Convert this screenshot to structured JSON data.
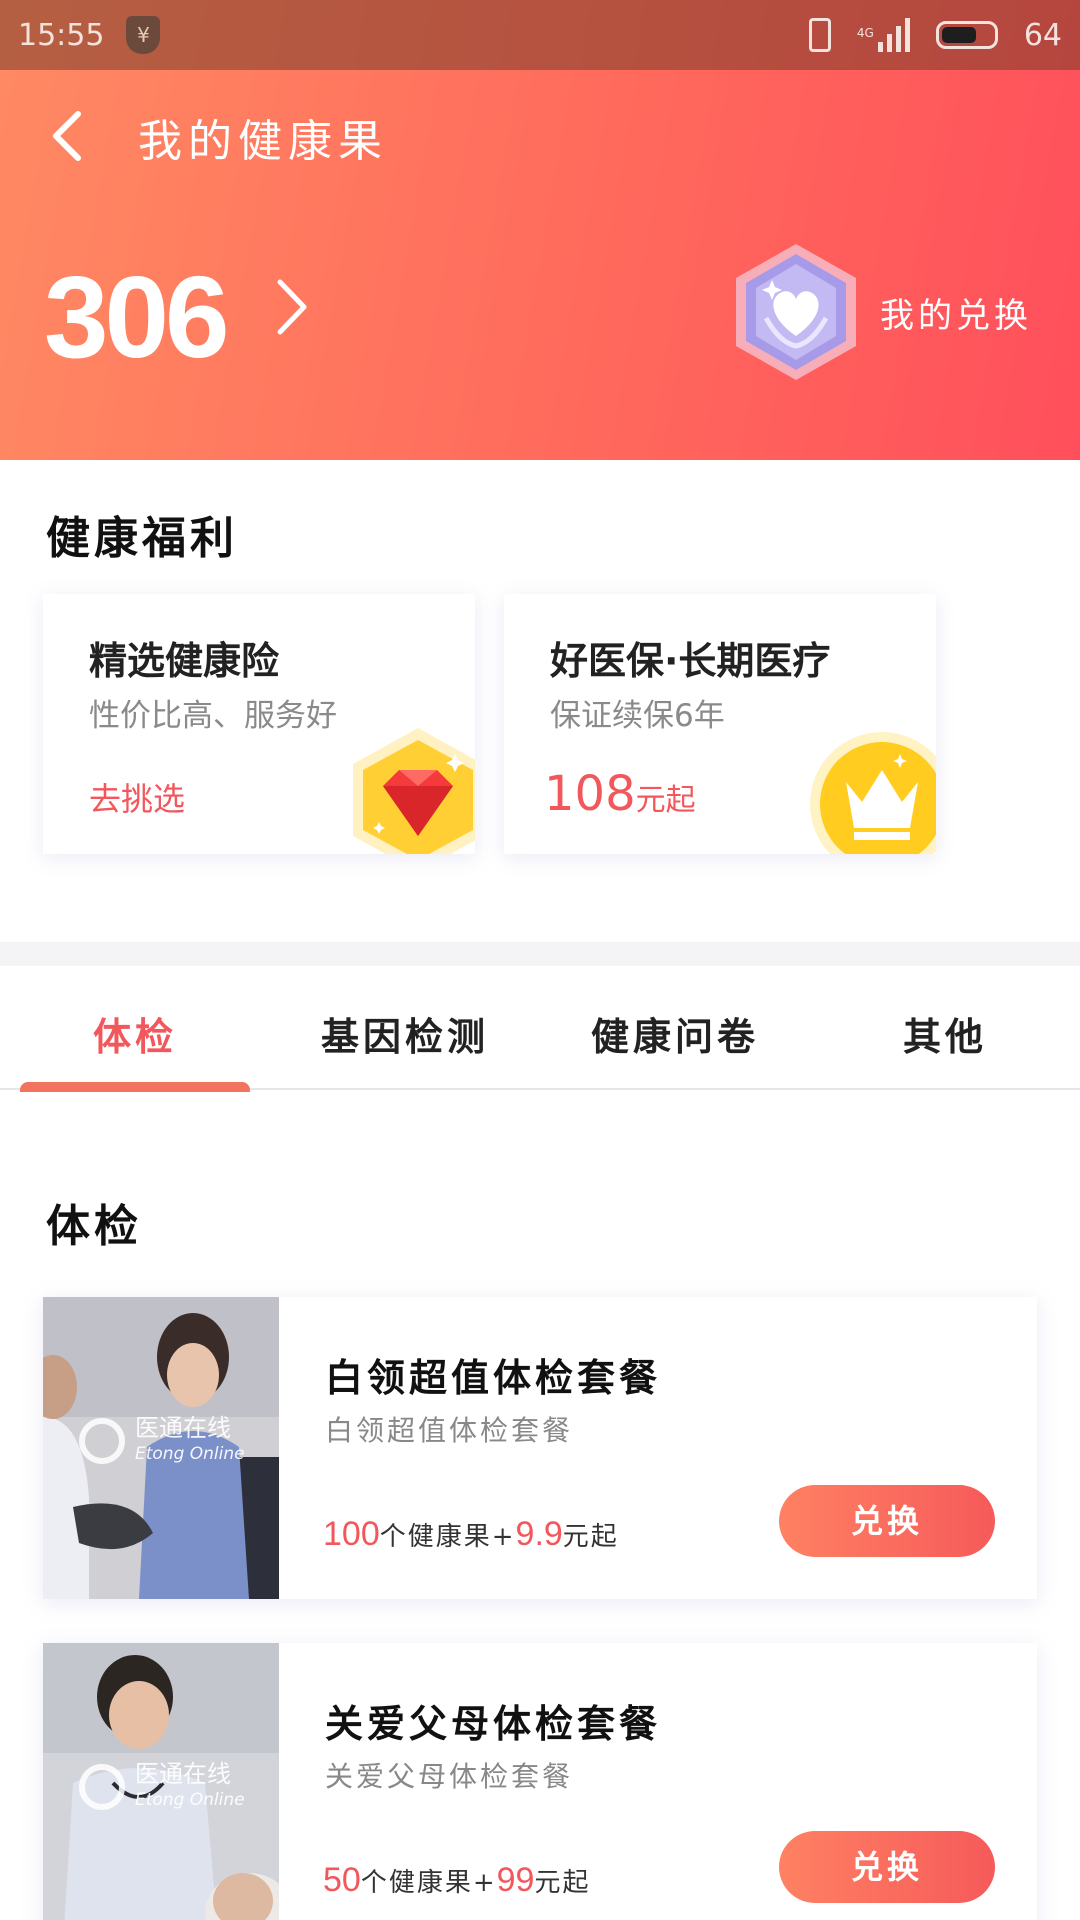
{
  "status_bar": {
    "time": "15:55",
    "battery": "64",
    "network": "4G"
  },
  "header": {
    "back_icon": "chevron-left-icon",
    "title": "我的健康果",
    "points": "306",
    "exchange_label": "我的兑换"
  },
  "benefits": {
    "title": "健康福利",
    "cards": [
      {
        "title": "精选健康险",
        "subtitle": "性价比高、服务好",
        "action": "去挑选",
        "badge_icon": "ruby-icon"
      },
      {
        "title": "好医保·长期医疗",
        "subtitle": "保证续保6年",
        "price_value": "108",
        "price_unit": "元起",
        "badge_icon": "crown-icon"
      }
    ]
  },
  "tabs": [
    {
      "label": "体检",
      "active": true
    },
    {
      "label": "基因检测",
      "active": false
    },
    {
      "label": "健康问卷",
      "active": false
    },
    {
      "label": "其他",
      "active": false
    }
  ],
  "section": {
    "title": "体检"
  },
  "products": [
    {
      "name": "白领超值体检套餐",
      "desc": "白领超值体检套餐",
      "points": "100",
      "points_unit": "个健康果+",
      "cash": "9.9",
      "cash_unit": "元起",
      "button": "兑换",
      "logo_cn": "医通在线",
      "logo_en": "Etong Online"
    },
    {
      "name": "关爱父母体检套餐",
      "desc": "关爱父母体检套餐",
      "points": "50",
      "points_unit": "个健康果+",
      "cash": "99",
      "cash_unit": "元起",
      "button": "兑换",
      "logo_cn": "医通在线",
      "logo_en": "Etong Online"
    }
  ],
  "colors": {
    "accent": "#f2575c",
    "header_start": "#ff8a63",
    "header_end": "#ff4f5c"
  }
}
